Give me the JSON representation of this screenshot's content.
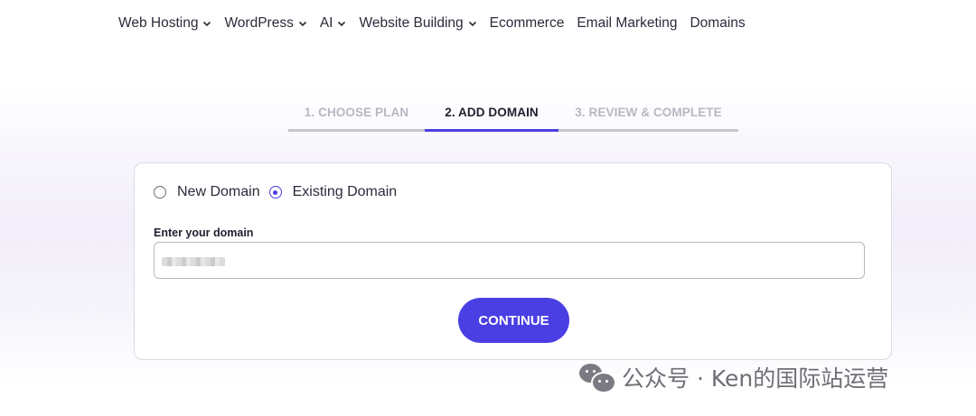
{
  "nav": {
    "items": [
      {
        "label": "Web Hosting",
        "has_dropdown": true
      },
      {
        "label": "WordPress",
        "has_dropdown": true
      },
      {
        "label": "AI",
        "has_dropdown": true
      },
      {
        "label": "Website Building",
        "has_dropdown": true
      },
      {
        "label": "Ecommerce",
        "has_dropdown": false
      },
      {
        "label": "Email Marketing",
        "has_dropdown": false
      },
      {
        "label": "Domains",
        "has_dropdown": false
      }
    ]
  },
  "stepper": {
    "steps": [
      {
        "label": "1. CHOOSE PLAN",
        "state": "inactive"
      },
      {
        "label": "2. ADD DOMAIN",
        "state": "active"
      },
      {
        "label": "3. REVIEW & COMPLETE",
        "state": "inactive"
      }
    ]
  },
  "domain_form": {
    "options": [
      {
        "label": "New Domain",
        "selected": false
      },
      {
        "label": "Existing Domain",
        "selected": true
      }
    ],
    "field_label": "Enter your domain",
    "field_value": "",
    "continue_label": "CONTINUE"
  },
  "watermark": {
    "text": "公众号 · Ken的国际站运营"
  },
  "colors": {
    "accent": "#4a3fe3",
    "inactive_step": "#b9b7c2",
    "text": "#1f1f2e"
  }
}
